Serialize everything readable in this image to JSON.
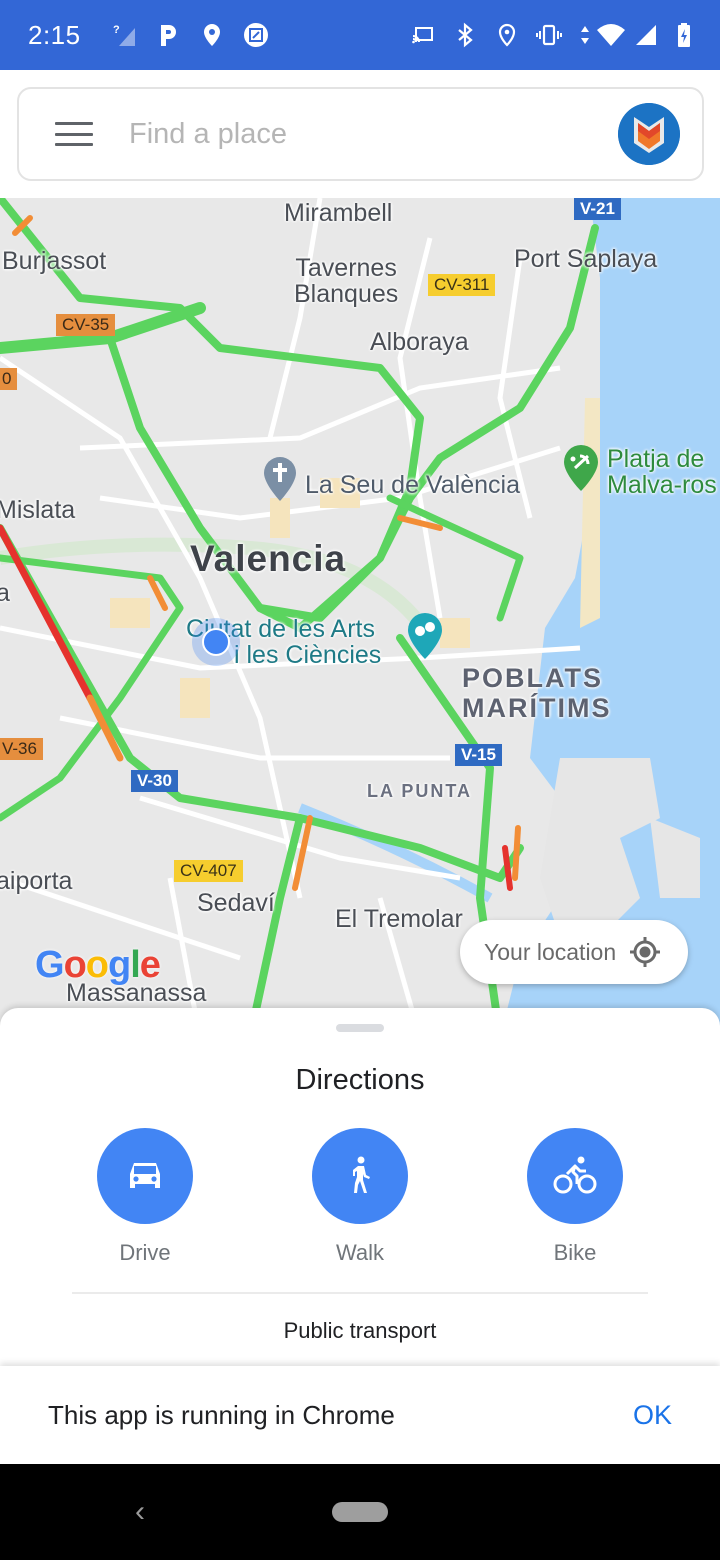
{
  "status_bar": {
    "time": "2:15",
    "left_icons": [
      "signal-unknown-icon",
      "parking-icon",
      "location-pin-icon",
      "screenshot-icon"
    ],
    "right_icons": [
      "cast-icon",
      "bluetooth-icon",
      "location-outline-icon",
      "vibrate-icon",
      "data-arrows-icon",
      "wifi-icon",
      "cell-signal-icon",
      "battery-charging-icon"
    ]
  },
  "search": {
    "placeholder": "Find a place",
    "value": ""
  },
  "map": {
    "place_labels": {
      "mirambell": "Mirambell",
      "burjassot": "Burjassot",
      "tavernes": "Tavernes\nBlanques",
      "port_saplaya": "Port Saplaya",
      "alboraya": "Alboraya",
      "mislata": "Mislata",
      "valencia": "Valencia",
      "aiporta": "aiporta",
      "sedavi": "Sedaví",
      "el_tremolar": "El Tremolar",
      "massanassa": "Massanassa",
      "poblats_1": "POBLATS",
      "poblats_2": "MARÍTIMS",
      "la_punta": "LA PUNTA",
      "edge_a": "a"
    },
    "pois": {
      "cathedral": "La Seu de València",
      "beach_1": "Platja de",
      "beach_2": "Malva-ros",
      "arts_1": "Ciutat de les Arts",
      "arts_2": "i les Ciències"
    },
    "road_shields": {
      "v21": "V-21",
      "cv311": "CV-311",
      "cv35": "CV-35",
      "cv30_partial": "0",
      "cv36": "V-36",
      "v30": "V-30",
      "v15": "V-15",
      "cv407": "CV-407"
    },
    "google_logo": [
      "G",
      "o",
      "o",
      "g",
      "l",
      "e"
    ],
    "google_colors": [
      "#4285f4",
      "#ea4335",
      "#fbbc05",
      "#4285f4",
      "#34a853",
      "#ea4335"
    ],
    "your_location_label": "Your location",
    "traffic_colors": {
      "fast": "#5bd45f",
      "slow": "#f28d36",
      "jam": "#e5322d"
    },
    "water_color": "#a7d3f9"
  },
  "sheet": {
    "title": "Directions",
    "modes": [
      {
        "label": "Drive",
        "icon": "car-icon"
      },
      {
        "label": "Walk",
        "icon": "walk-icon"
      },
      {
        "label": "Bike",
        "icon": "bike-icon"
      }
    ],
    "public_transport_label": "Public transport",
    "accent": "#4285f4"
  },
  "banner": {
    "message": "This app is running in Chrome",
    "ok_label": "OK"
  },
  "nav": {
    "back_glyph": "‹"
  }
}
